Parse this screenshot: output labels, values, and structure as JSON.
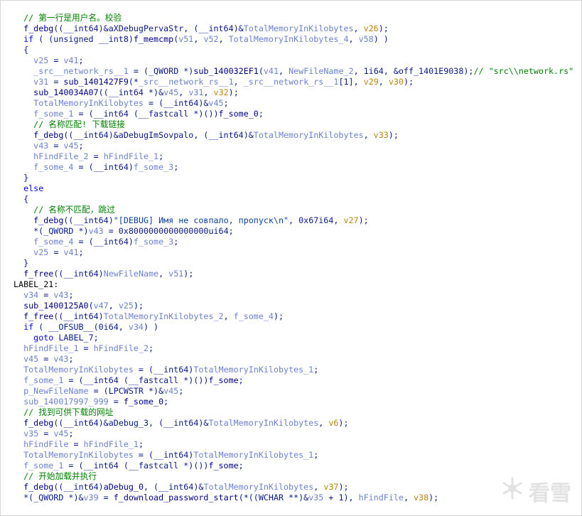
{
  "colors": {
    "keyword": "#0000ff",
    "function": "#00008b",
    "variable": "#6c82cf",
    "argument": "#b8860b",
    "string": "#0a3fa0",
    "comment": "#008000",
    "punct": "#0a1a8a"
  },
  "watermark": {
    "text": "看雪",
    "icon": "snowflake-icon"
  },
  "code_lines": [
    [
      {
        "c": "p",
        "t": "  "
      },
      {
        "c": "com",
        "t": "// 第一行是用户名。校验"
      }
    ],
    [
      {
        "c": "p",
        "t": "  "
      },
      {
        "c": "fn",
        "t": "f_debg"
      },
      {
        "c": "p",
        "t": "((__int64)&aXDebugPervaStr, (__int64)&"
      },
      {
        "c": "var",
        "t": "TotalMemoryInKilobytes"
      },
      {
        "c": "p",
        "t": ", "
      },
      {
        "c": "arg",
        "t": "v26"
      },
      {
        "c": "p",
        "t": ");"
      }
    ],
    [
      {
        "c": "p",
        "t": "  "
      },
      {
        "c": "kw",
        "t": "if"
      },
      {
        "c": "p",
        "t": " ( (unsigned __int8)"
      },
      {
        "c": "fn",
        "t": "f_memcmp"
      },
      {
        "c": "p",
        "t": "("
      },
      {
        "c": "var",
        "t": "v51"
      },
      {
        "c": "p",
        "t": ", "
      },
      {
        "c": "var",
        "t": "v52"
      },
      {
        "c": "p",
        "t": ", "
      },
      {
        "c": "var",
        "t": "TotalMemoryInKilobytes_4"
      },
      {
        "c": "p",
        "t": ", "
      },
      {
        "c": "var",
        "t": "v58"
      },
      {
        "c": "p",
        "t": ") )"
      }
    ],
    [
      {
        "c": "p",
        "t": "  {"
      }
    ],
    [
      {
        "c": "p",
        "t": "    "
      },
      {
        "c": "var",
        "t": "v25"
      },
      {
        "c": "p",
        "t": " = "
      },
      {
        "c": "var",
        "t": "v41"
      },
      {
        "c": "p",
        "t": ";"
      }
    ],
    [
      {
        "c": "p",
        "t": "    "
      },
      {
        "c": "var",
        "t": "_src__network_rs__1"
      },
      {
        "c": "p",
        "t": " = (_QWORD *)"
      },
      {
        "c": "fn",
        "t": "sub_140032EF1"
      },
      {
        "c": "p",
        "t": "("
      },
      {
        "c": "var",
        "t": "v41"
      },
      {
        "c": "p",
        "t": ", "
      },
      {
        "c": "var",
        "t": "NewFileName_2"
      },
      {
        "c": "p",
        "t": ", 1i64, &off_1401E9038);"
      },
      {
        "c": "com",
        "t": "// \"src\\\\network.rs\""
      }
    ],
    [
      {
        "c": "p",
        "t": "    "
      },
      {
        "c": "var",
        "t": "v31"
      },
      {
        "c": "p",
        "t": " = "
      },
      {
        "c": "fn",
        "t": "sub_1401427F9"
      },
      {
        "c": "p",
        "t": "(*"
      },
      {
        "c": "var",
        "t": "_src__network_rs__1"
      },
      {
        "c": "p",
        "t": ", "
      },
      {
        "c": "var",
        "t": "_src__network_rs__1"
      },
      {
        "c": "p",
        "t": "[1], "
      },
      {
        "c": "arg",
        "t": "v29"
      },
      {
        "c": "p",
        "t": ", "
      },
      {
        "c": "arg",
        "t": "v30"
      },
      {
        "c": "p",
        "t": ");"
      }
    ],
    [
      {
        "c": "p",
        "t": "    "
      },
      {
        "c": "fn",
        "t": "sub_140034A07"
      },
      {
        "c": "p",
        "t": "((__int64 *)&"
      },
      {
        "c": "var",
        "t": "v45"
      },
      {
        "c": "p",
        "t": ", "
      },
      {
        "c": "var",
        "t": "v31"
      },
      {
        "c": "p",
        "t": ", "
      },
      {
        "c": "arg",
        "t": "v32"
      },
      {
        "c": "p",
        "t": ");"
      }
    ],
    [
      {
        "c": "p",
        "t": "    "
      },
      {
        "c": "var",
        "t": "TotalMemoryInKilobytes"
      },
      {
        "c": "p",
        "t": " = (__int64)&"
      },
      {
        "c": "var",
        "t": "v45"
      },
      {
        "c": "p",
        "t": ";"
      }
    ],
    [
      {
        "c": "p",
        "t": "    "
      },
      {
        "c": "var",
        "t": "f_some_1"
      },
      {
        "c": "p",
        "t": " = (__int64 (__fastcall *)())"
      },
      {
        "c": "fn",
        "t": "f_some_0"
      },
      {
        "c": "p",
        "t": ";"
      }
    ],
    [
      {
        "c": "p",
        "t": "    "
      },
      {
        "c": "com",
        "t": "// 名称匹配! 下载链接"
      }
    ],
    [
      {
        "c": "p",
        "t": "    "
      },
      {
        "c": "fn",
        "t": "f_debg"
      },
      {
        "c": "p",
        "t": "((__int64)&aDebugImSovpalo, (__int64)&"
      },
      {
        "c": "var",
        "t": "TotalMemoryInKilobytes"
      },
      {
        "c": "p",
        "t": ", "
      },
      {
        "c": "arg",
        "t": "v33"
      },
      {
        "c": "p",
        "t": ");"
      }
    ],
    [
      {
        "c": "p",
        "t": "    "
      },
      {
        "c": "var",
        "t": "v43"
      },
      {
        "c": "p",
        "t": " = "
      },
      {
        "c": "var",
        "t": "v45"
      },
      {
        "c": "p",
        "t": ";"
      }
    ],
    [
      {
        "c": "p",
        "t": "    "
      },
      {
        "c": "var",
        "t": "hFindFile_2"
      },
      {
        "c": "p",
        "t": " = "
      },
      {
        "c": "var",
        "t": "hFindFile_1"
      },
      {
        "c": "p",
        "t": ";"
      }
    ],
    [
      {
        "c": "p",
        "t": "    "
      },
      {
        "c": "var",
        "t": "f_some_4"
      },
      {
        "c": "p",
        "t": " = (__int64)"
      },
      {
        "c": "var",
        "t": "f_some_3"
      },
      {
        "c": "p",
        "t": ";"
      }
    ],
    [
      {
        "c": "p",
        "t": "  }"
      }
    ],
    [
      {
        "c": "p",
        "t": "  "
      },
      {
        "c": "kw",
        "t": "else"
      }
    ],
    [
      {
        "c": "p",
        "t": "  {"
      }
    ],
    [
      {
        "c": "p",
        "t": "    "
      },
      {
        "c": "com",
        "t": "// 名称不匹配，跳过"
      }
    ],
    [
      {
        "c": "p",
        "t": "    "
      },
      {
        "c": "fn",
        "t": "f_debg"
      },
      {
        "c": "p",
        "t": "((__int64)"
      },
      {
        "c": "str",
        "t": "\"[DEBUG] Имя не совпало, пропуск\\n\""
      },
      {
        "c": "p",
        "t": ", 0x67i64, "
      },
      {
        "c": "arg",
        "t": "v27"
      },
      {
        "c": "p",
        "t": ");"
      }
    ],
    [
      {
        "c": "p",
        "t": "    *(_QWORD *)"
      },
      {
        "c": "var",
        "t": "v43"
      },
      {
        "c": "p",
        "t": " = 0x8000000000000000ui64;"
      }
    ],
    [
      {
        "c": "p",
        "t": "    "
      },
      {
        "c": "var",
        "t": "f_some_4"
      },
      {
        "c": "p",
        "t": " = (__int64)"
      },
      {
        "c": "var",
        "t": "f_some_3"
      },
      {
        "c": "p",
        "t": ";"
      }
    ],
    [
      {
        "c": "p",
        "t": "    "
      },
      {
        "c": "var",
        "t": "v25"
      },
      {
        "c": "p",
        "t": " = "
      },
      {
        "c": "var",
        "t": "v41"
      },
      {
        "c": "p",
        "t": ";"
      }
    ],
    [
      {
        "c": "p",
        "t": "  }"
      }
    ],
    [
      {
        "c": "p",
        "t": "  "
      },
      {
        "c": "fn",
        "t": "f_free"
      },
      {
        "c": "p",
        "t": "((__int64)"
      },
      {
        "c": "var",
        "t": "NewFileName"
      },
      {
        "c": "p",
        "t": ", "
      },
      {
        "c": "var",
        "t": "v51"
      },
      {
        "c": "p",
        "t": ");"
      }
    ],
    [
      {
        "c": "lbl",
        "t": "LABEL_21:"
      }
    ],
    [
      {
        "c": "p",
        "t": "  "
      },
      {
        "c": "var",
        "t": "v34"
      },
      {
        "c": "p",
        "t": " = "
      },
      {
        "c": "var",
        "t": "v43"
      },
      {
        "c": "p",
        "t": ";"
      }
    ],
    [
      {
        "c": "p",
        "t": "  "
      },
      {
        "c": "fn",
        "t": "sub_1400125A0"
      },
      {
        "c": "p",
        "t": "("
      },
      {
        "c": "var",
        "t": "v47"
      },
      {
        "c": "p",
        "t": ", "
      },
      {
        "c": "var",
        "t": "v25"
      },
      {
        "c": "p",
        "t": ");"
      }
    ],
    [
      {
        "c": "p",
        "t": "  "
      },
      {
        "c": "fn",
        "t": "f_free"
      },
      {
        "c": "p",
        "t": "((__int64)"
      },
      {
        "c": "var",
        "t": "TotalMemoryInKilobytes_2"
      },
      {
        "c": "p",
        "t": ", "
      },
      {
        "c": "var",
        "t": "f_some_4"
      },
      {
        "c": "p",
        "t": ");"
      }
    ],
    [
      {
        "c": "p",
        "t": "  "
      },
      {
        "c": "kw",
        "t": "if"
      },
      {
        "c": "p",
        "t": " ( __OFSUB__(0i64, "
      },
      {
        "c": "var",
        "t": "v34"
      },
      {
        "c": "p",
        "t": ") )"
      }
    ],
    [
      {
        "c": "p",
        "t": "    "
      },
      {
        "c": "kw",
        "t": "goto"
      },
      {
        "c": "p",
        "t": " LABEL_7;"
      }
    ],
    [
      {
        "c": "p",
        "t": "  "
      },
      {
        "c": "var",
        "t": "hFindFile_1"
      },
      {
        "c": "p",
        "t": " = "
      },
      {
        "c": "var",
        "t": "hFindFile_2"
      },
      {
        "c": "p",
        "t": ";"
      }
    ],
    [
      {
        "c": "p",
        "t": "  "
      },
      {
        "c": "var",
        "t": "v45"
      },
      {
        "c": "p",
        "t": " = "
      },
      {
        "c": "var",
        "t": "v43"
      },
      {
        "c": "p",
        "t": ";"
      }
    ],
    [
      {
        "c": "p",
        "t": "  "
      },
      {
        "c": "var",
        "t": "TotalMemoryInKilobytes"
      },
      {
        "c": "p",
        "t": " = (__int64)"
      },
      {
        "c": "var",
        "t": "TotalMemoryInKilobytes_1"
      },
      {
        "c": "p",
        "t": ";"
      }
    ],
    [
      {
        "c": "p",
        "t": "  "
      },
      {
        "c": "var",
        "t": "f_some_1"
      },
      {
        "c": "p",
        "t": " = (__int64 (__fastcall *)())"
      },
      {
        "c": "fn",
        "t": "f_some"
      },
      {
        "c": "p",
        "t": ";"
      }
    ],
    [
      {
        "c": "p",
        "t": "  "
      },
      {
        "c": "var",
        "t": "p_NewFileName"
      },
      {
        "c": "p",
        "t": " = (LPCWSTR *)&"
      },
      {
        "c": "var",
        "t": "v45"
      },
      {
        "c": "p",
        "t": ";"
      }
    ],
    [
      {
        "c": "p",
        "t": "  "
      },
      {
        "c": "var",
        "t": "sub_140017997_999"
      },
      {
        "c": "p",
        "t": " = "
      },
      {
        "c": "fn",
        "t": "f_some_0"
      },
      {
        "c": "p",
        "t": ";"
      }
    ],
    [
      {
        "c": "p",
        "t": "  "
      },
      {
        "c": "com",
        "t": "// 找到可供下载的网址"
      }
    ],
    [
      {
        "c": "p",
        "t": "  "
      },
      {
        "c": "fn",
        "t": "f_debg"
      },
      {
        "c": "p",
        "t": "((__int64)&aDebug_3, (__int64)&"
      },
      {
        "c": "var",
        "t": "TotalMemoryInKilobytes"
      },
      {
        "c": "p",
        "t": ", "
      },
      {
        "c": "arg",
        "t": "v6"
      },
      {
        "c": "p",
        "t": ");"
      }
    ],
    [
      {
        "c": "p",
        "t": "  "
      },
      {
        "c": "var",
        "t": "v35"
      },
      {
        "c": "p",
        "t": " = "
      },
      {
        "c": "var",
        "t": "v45"
      },
      {
        "c": "p",
        "t": ";"
      }
    ],
    [
      {
        "c": "p",
        "t": "  "
      },
      {
        "c": "var",
        "t": "hFindFile"
      },
      {
        "c": "p",
        "t": " = "
      },
      {
        "c": "var",
        "t": "hFindFile_1"
      },
      {
        "c": "p",
        "t": ";"
      }
    ],
    [
      {
        "c": "p",
        "t": "  "
      },
      {
        "c": "var",
        "t": "TotalMemoryInKilobytes"
      },
      {
        "c": "p",
        "t": " = (__int64)"
      },
      {
        "c": "var",
        "t": "TotalMemoryInKilobytes_1"
      },
      {
        "c": "p",
        "t": ";"
      }
    ],
    [
      {
        "c": "p",
        "t": "  "
      },
      {
        "c": "var",
        "t": "f_some_1"
      },
      {
        "c": "p",
        "t": " = (__int64 (__fastcall *)())"
      },
      {
        "c": "fn",
        "t": "f_some"
      },
      {
        "c": "p",
        "t": ";"
      }
    ],
    [
      {
        "c": "p",
        "t": "  "
      },
      {
        "c": "com",
        "t": "// 开始加载并执行"
      }
    ],
    [
      {
        "c": "p",
        "t": "  "
      },
      {
        "c": "fn",
        "t": "f_debg"
      },
      {
        "c": "p",
        "t": "((__int64)"
      },
      {
        "c": "fn",
        "t": "aDebug_0"
      },
      {
        "c": "p",
        "t": ", (__int64)&"
      },
      {
        "c": "var",
        "t": "TotalMemoryInKilobytes"
      },
      {
        "c": "p",
        "t": ", "
      },
      {
        "c": "arg",
        "t": "v37"
      },
      {
        "c": "p",
        "t": ");"
      }
    ],
    [
      {
        "c": "p",
        "t": "  *(_QWORD *)&"
      },
      {
        "c": "var",
        "t": "v39"
      },
      {
        "c": "p",
        "t": " = "
      },
      {
        "c": "fn",
        "t": "f_download_password_start"
      },
      {
        "c": "p",
        "t": "(*((WCHAR **)&"
      },
      {
        "c": "var",
        "t": "v35"
      },
      {
        "c": "p",
        "t": " + 1), "
      },
      {
        "c": "var",
        "t": "hFindFile"
      },
      {
        "c": "p",
        "t": ", "
      },
      {
        "c": "arg",
        "t": "v38"
      },
      {
        "c": "p",
        "t": ");"
      }
    ]
  ]
}
